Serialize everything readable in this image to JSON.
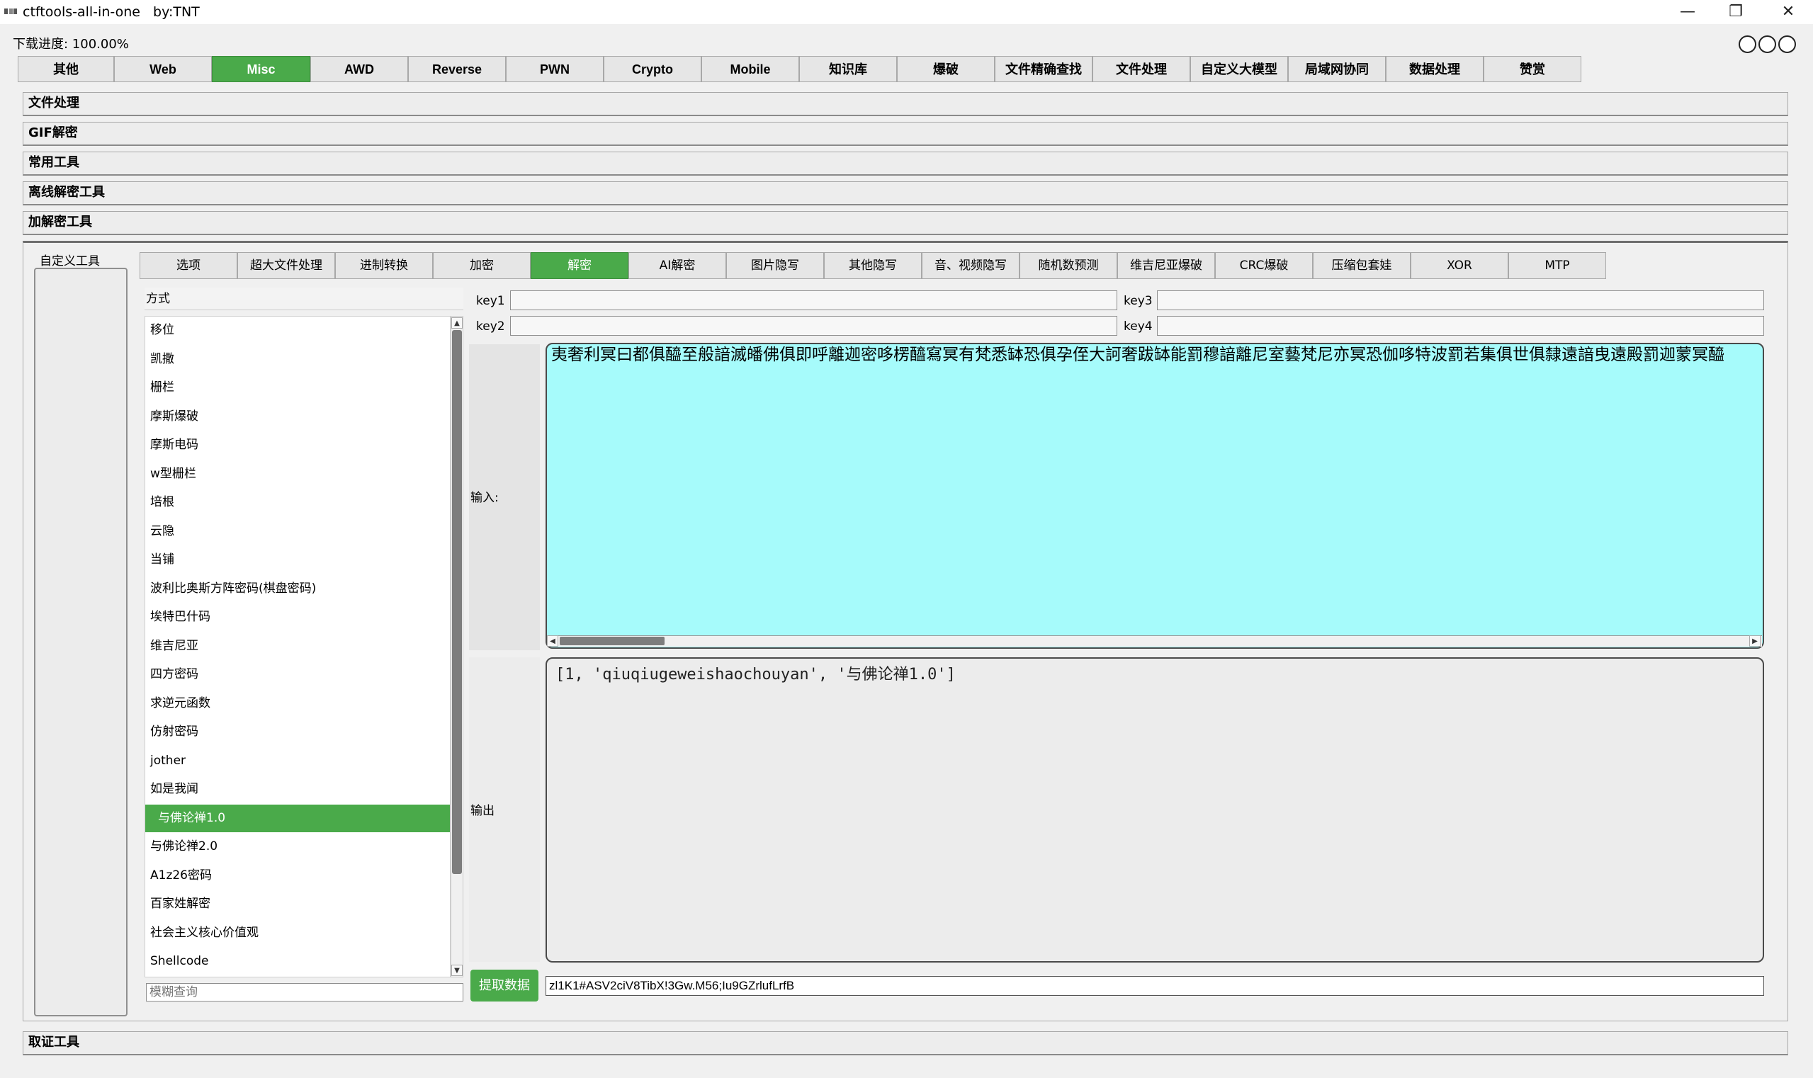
{
  "window": {
    "title": "ctftools-all-in-one   by:TNT",
    "minimize": "—",
    "restore": "❐",
    "close": "✕"
  },
  "progress": "下载进度: 100.00%",
  "main_tabs": [
    "其他",
    "Web",
    "Misc",
    "AWD",
    "Reverse",
    "PWN",
    "Crypto",
    "Mobile",
    "知识库",
    "爆破",
    "文件精确查找",
    "文件处理",
    "自定义大模型",
    "局域网协同",
    "数据处理",
    "赞赏"
  ],
  "main_tab_active": "Misc",
  "sections": [
    "文件处理",
    "GIF解密",
    "常用工具",
    "离线解密工具",
    "加解密工具"
  ],
  "bottom_section": "取证工具",
  "custom_tools_label": "自定义工具",
  "sub_tabs": [
    "选项",
    "超大文件处理",
    "进制转换",
    "加密",
    "解密",
    "AI解密",
    "图片隐写",
    "其他隐写",
    "音、视频隐写",
    "随机数预测",
    "维吉尼亚爆破",
    "CRC爆破",
    "压缩包套娃",
    "XOR",
    "MTP"
  ],
  "sub_tab_active": "解密",
  "method_header": "方式",
  "methods": [
    "移位",
    "凯撒",
    "栅栏",
    "摩斯爆破",
    "摩斯电码",
    "w型栅栏",
    "培根",
    "云隐",
    "当铺",
    "波利比奥斯方阵密码(棋盘密码)",
    "埃特巴什码",
    "维吉尼亚",
    "四方密码",
    "求逆元函数",
    "仿射密码",
    "jother",
    "如是我闻",
    "与佛论禅1.0",
    "与佛论禅2.0",
    "A1z26密码",
    "百家姓解密",
    "社会主义核心价值观",
    "Shellcode"
  ],
  "selected_method": "与佛论禅1.0",
  "search_placeholder": "模糊查询",
  "keys": {
    "key1": "key1",
    "key2": "key2",
    "key3": "key3",
    "key4": "key4"
  },
  "input_label": "输入:",
  "input_text": "夷奢利冥曰都俱醯至般諳滅皤佛俱即呼離迦密哆楞醯寫冥有梵悉缽恐俱孕侄大訶奢跋缽能罰穆諳離尼室藝梵尼亦冥恐伽哆特波罰若集俱世俱隸遠諳曳遠殿罰迦蒙冥醯",
  "output_label": "输出",
  "output_text": "[1, 'qiuqiugeweishaochouyan', '与佛论禅1.0']",
  "extract_button": "提取数据",
  "extract_value": "zl1K1#ASV2ciV8TibX!3Gw.M56;Iu9GZrlufLrfB",
  "colors": {
    "accent_green": "#4aaa4a",
    "input_bg": "#a6fbfb"
  }
}
